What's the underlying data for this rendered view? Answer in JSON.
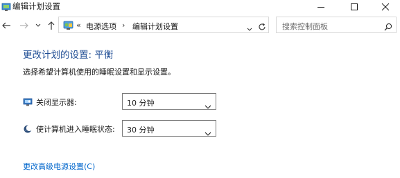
{
  "window": {
    "title": "编辑计划设置",
    "icon": "control-panel-icon",
    "controls": [
      "minimize-icon",
      "maximize-icon",
      "close-icon"
    ]
  },
  "nav": {
    "back_icon": "back-arrow-icon",
    "forward_icon": "forward-arrow-icon",
    "recent_icon": "chevron-down-icon",
    "up_icon": "up-arrow-icon"
  },
  "address": {
    "overflow": "«",
    "separator": "›",
    "breadcrumbs": [
      "电源选项",
      "编辑计划设置"
    ]
  },
  "search": {
    "placeholder": "搜索控制面板"
  },
  "content": {
    "heading": "更改计划的设置: 平衡",
    "subheading": "选择希望计算机使用的睡眠设置和显示设置。",
    "settings": [
      {
        "label": "关闭显示器:",
        "value": "10 分钟",
        "icon": "monitor-icon"
      },
      {
        "label": "使计算机进入睡眠状态:",
        "value": "30 分钟",
        "icon": "moon-icon"
      }
    ],
    "advanced_link": "更改高级电源设置(C)"
  },
  "colors": {
    "heading": "#1f4d94",
    "link": "#0066cc",
    "border": "#d9d9d9"
  }
}
